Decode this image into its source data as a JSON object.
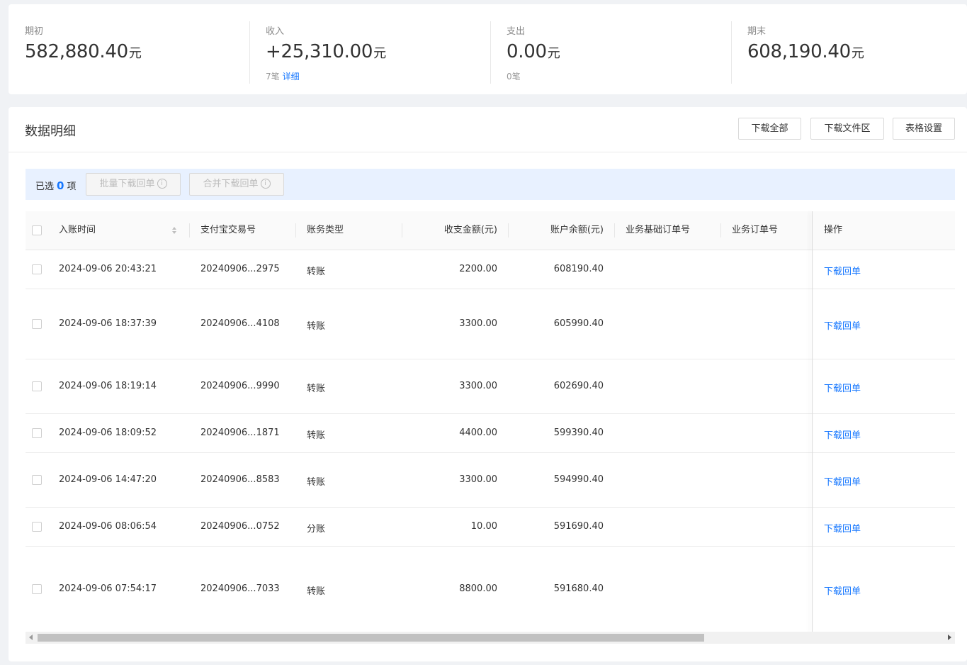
{
  "summary": {
    "opening": {
      "label": "期初",
      "amount": "582,880.40",
      "unit": "元"
    },
    "income": {
      "label": "收入",
      "amount": "+25,310.00",
      "unit": "元",
      "count": "7笔",
      "detail_link": "详细"
    },
    "expense": {
      "label": "支出",
      "amount": "0.00",
      "unit": "元",
      "count": "0笔"
    },
    "closing": {
      "label": "期末",
      "amount": "608,190.40",
      "unit": "元"
    }
  },
  "detail": {
    "title": "数据明细",
    "buttons": {
      "download_all": "下载全部",
      "download_area": "下载文件区",
      "table_settings": "表格设置"
    }
  },
  "selection": {
    "prefix": "已选",
    "count": "0",
    "suffix": "项",
    "batch_download": "批量下载回单",
    "merge_download": "合并下载回单"
  },
  "table": {
    "columns": {
      "time": "入账时间",
      "txn": "支付宝交易号",
      "type": "账务类型",
      "amount": "收支金额(元)",
      "balance": "账户余额(元)",
      "base_order": "业务基础订单号",
      "order": "业务订单号",
      "action": "操作"
    },
    "rows": [
      {
        "time": "2024-09-06 20:43:21",
        "txn": "20240906...2975",
        "type": "转账",
        "amount": "2200.00",
        "balance": "608190.40",
        "base_order": "",
        "order": "",
        "action": "下载回单"
      },
      {
        "time": "2024-09-06 18:37:39",
        "txn": "20240906...4108",
        "type": "转账",
        "amount": "3300.00",
        "balance": "605990.40",
        "base_order": "",
        "order": "",
        "action": "下载回单"
      },
      {
        "time": "2024-09-06 18:19:14",
        "txn": "20240906...9990",
        "type": "转账",
        "amount": "3300.00",
        "balance": "602690.40",
        "base_order": "",
        "order": "",
        "action": "下载回单"
      },
      {
        "time": "2024-09-06 18:09:52",
        "txn": "20240906...1871",
        "type": "转账",
        "amount": "4400.00",
        "balance": "599390.40",
        "base_order": "",
        "order": "",
        "action": "下载回单"
      },
      {
        "time": "2024-09-06 14:47:20",
        "txn": "20240906...8583",
        "type": "转账",
        "amount": "3300.00",
        "balance": "594990.40",
        "base_order": "",
        "order": "",
        "action": "下载回单"
      },
      {
        "time": "2024-09-06 08:06:54",
        "txn": "20240906...0752",
        "type": "分账",
        "amount": "10.00",
        "balance": "591690.40",
        "base_order": "",
        "order": "",
        "action": "下载回单"
      },
      {
        "time": "2024-09-06 07:54:17",
        "txn": "20240906...7033",
        "type": "转账",
        "amount": "8800.00",
        "balance": "591680.40",
        "base_order": "",
        "order": "",
        "action": "下载回单"
      }
    ]
  },
  "colors": {
    "accent": "#1677ff",
    "page_bg": "#f0f2f5",
    "select_bar_bg": "#e8f1ff"
  }
}
